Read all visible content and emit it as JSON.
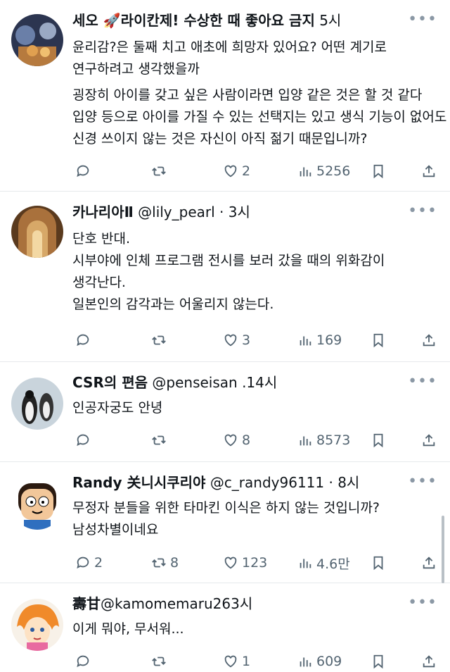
{
  "posts": [
    {
      "name": "세오 🚀라이칸제! 수상한 때 좋아요 금지",
      "handle": "",
      "time": "5시",
      "lines": [
        "윤리감?은 둘째 치고 애초에 희망자 있어요? 어떤 계기로",
        "연구하려고 생각했을까",
        "굉장히 아이를 갖고 싶은 사람이라면 입양 같은 것은 할 것 같다",
        "입양 등으로 아이를 가질 수 있는 선택지는 있고 생식 기능이 없어도",
        "신경 쓰이지 않는 것은 자신이 아직 젊기 때문입니까?"
      ],
      "replies": "",
      "reposts": "",
      "likes": "2",
      "views": "5256"
    },
    {
      "name": "카나리아Ⅱ",
      "handle": "@lily_pearl",
      "time": "· 3시",
      "lines": [
        "단호 반대.",
        "시부야에 인체 프로그램 전시를 보러 갔을 때의 위화감이",
        "생각난다.",
        "일본인의 감각과는 어울리지 않는다."
      ],
      "replies": "",
      "reposts": "",
      "likes": "3",
      "views": "169"
    },
    {
      "name": "CSR의 편음",
      "handle": "@penseisan",
      "time": ".14시",
      "lines": [
        "인공자궁도 안녕"
      ],
      "replies": "",
      "reposts": "",
      "likes": "8",
      "views": "8573"
    },
    {
      "name": "Randy 关니시쿠리야",
      "handle": "@c_randy96111",
      "time": "· 8시",
      "lines": [
        "무정자 분들을 위한 타마킨 이식은 하지 않는 것입니까?",
        "남성차별이네요"
      ],
      "replies": "2",
      "reposts": "8",
      "likes": "123",
      "views": "4.6만"
    },
    {
      "name": "壽甘",
      "handle": "@kamomemaru263",
      "time": "시",
      "lines": [
        "이게 뭐야, 무서워..."
      ],
      "replies": "",
      "reposts": "",
      "likes": "1",
      "views": "609"
    }
  ],
  "icons": {
    "reply": "speech-bubble-icon",
    "repost": "repost-arrows-icon",
    "like": "heart-icon",
    "views": "bar-chart-icon",
    "bookmark": "bookmark-icon",
    "share": "share-upload-icon",
    "more": "more-dots-icon"
  }
}
